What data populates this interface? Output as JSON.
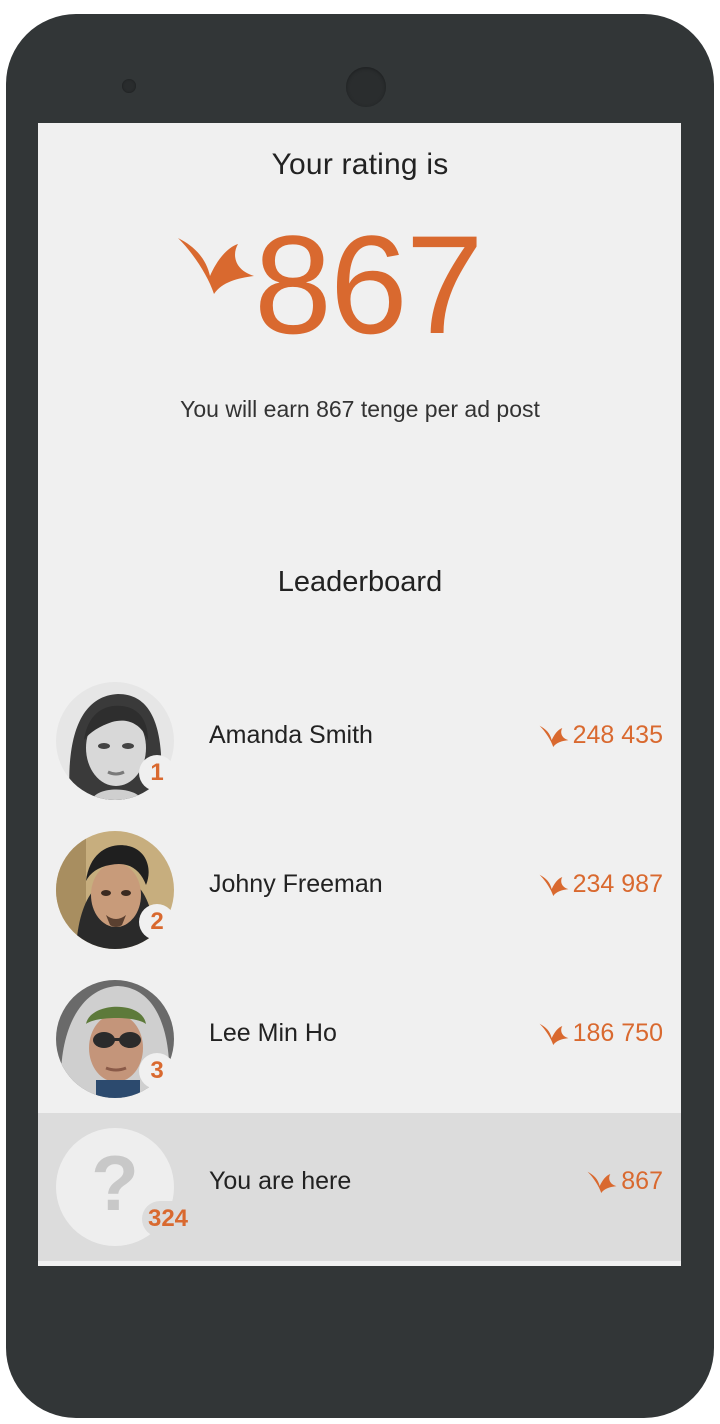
{
  "rating": {
    "title": "Your rating is",
    "value": "867",
    "earn_text": "You will earn 867 tenge per ad post"
  },
  "leaderboard": {
    "title": "Leaderboard",
    "entries": [
      {
        "rank": "1",
        "name": "Amanda Smith",
        "score": "248 435"
      },
      {
        "rank": "2",
        "name": "Johny Freeman",
        "score": "234 987"
      },
      {
        "rank": "3",
        "name": "Lee Min Ho",
        "score": "186 750"
      }
    ],
    "me": {
      "rank": "324",
      "avatar_glyph": "?",
      "name": "You are here",
      "score": "867"
    }
  },
  "colors": {
    "accent": "#d9692f",
    "screen_bg": "#f0f0f0",
    "highlight_row": "#dcdcdc",
    "phone_body": "#323637"
  },
  "icons": {
    "rating_logo": "bird-icon",
    "score_logo": "bird-icon",
    "unknown_avatar": "question-mark-icon"
  }
}
